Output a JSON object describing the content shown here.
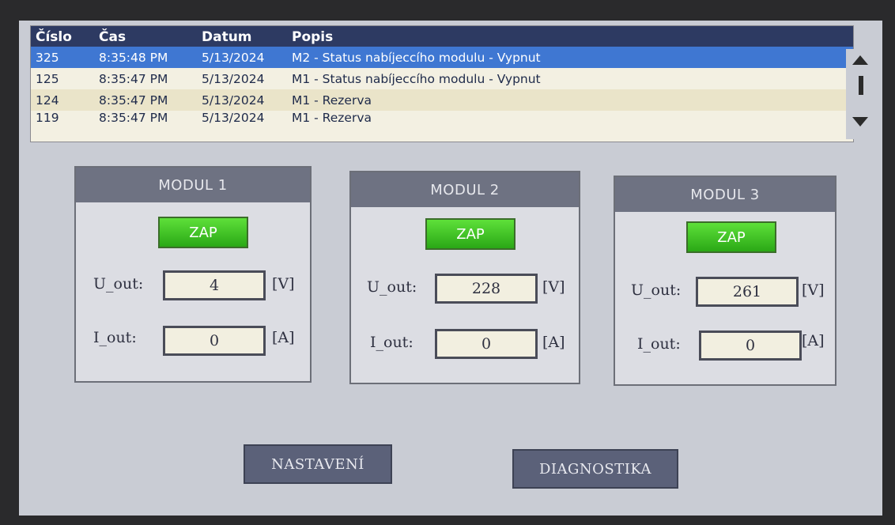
{
  "alarm_table": {
    "headers": {
      "num": "Číslo",
      "time": "Čas",
      "date": "Datum",
      "desc": "Popis"
    },
    "rows": [
      {
        "num": "325",
        "time": "8:35:48 PM",
        "date": "5/13/2024",
        "desc": "M2 - Status nabíjeccího modulu - Vypnut"
      },
      {
        "num": "125",
        "time": "8:35:47 PM",
        "date": "5/13/2024",
        "desc": "M1 - Status nabíjeccího modulu - Vypnut"
      },
      {
        "num": "124",
        "time": "8:35:47 PM",
        "date": "5/13/2024",
        "desc": "M1 - Rezerva"
      },
      {
        "num": "119",
        "time": "8:35:47 PM",
        "date": "5/13/2024",
        "desc": "M1 - Rezerva"
      }
    ]
  },
  "modules": [
    {
      "title": "MODUL 1",
      "status": "ZAP",
      "u_label": "U_out:",
      "u_value": "4",
      "u_unit": "[V]",
      "i_label": "I_out:",
      "i_value": "0",
      "i_unit": "[A]"
    },
    {
      "title": "MODUL 2",
      "status": "ZAP",
      "u_label": "U_out:",
      "u_value": "228",
      "u_unit": "[V]",
      "i_label": "I_out:",
      "i_value": "0",
      "i_unit": "[A]"
    },
    {
      "title": "MODUL 3",
      "status": "ZAP",
      "u_label": "U_out:",
      "u_value": "261",
      "u_unit": "[V]",
      "i_label": "I_out:",
      "i_value": "0",
      "i_unit": "[A]"
    }
  ],
  "buttons": {
    "settings": "NASTAVENÍ",
    "diagnostics": "DIAGNOSTIKA"
  },
  "colors": {
    "status_on": "#3cc425",
    "header_bg": "#2d3a62",
    "selected_row": "#3f77d2",
    "button_bg": "#5b6179"
  }
}
